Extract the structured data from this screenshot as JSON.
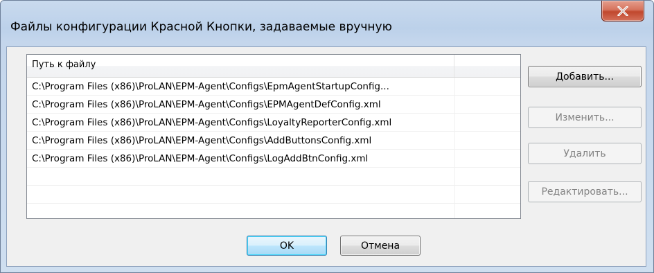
{
  "window": {
    "title": "Файлы конфигурации Красной Кнопки, задаваемые вручную",
    "close_icon": "close-x-icon"
  },
  "list": {
    "column_header": "Путь к файлу",
    "rows": [
      "C:\\Program Files (x86)\\ProLAN\\EPM-Agent\\Configs\\EpmAgentStartupConfig...",
      "C:\\Program Files (x86)\\ProLAN\\EPM-Agent\\Configs\\EPMAgentDefConfig.xml",
      "C:\\Program Files (x86)\\ProLAN\\EPM-Agent\\Configs\\LoyaltyReporterConfig.xml",
      "C:\\Program Files (x86)\\ProLAN\\EPM-Agent\\Configs\\AddButtonsConfig.xml",
      "C:\\Program Files (x86)\\ProLAN\\EPM-Agent\\Configs\\LogAddBtnConfig.xml"
    ]
  },
  "buttons": {
    "add": "Добавить...",
    "edit": "Изменить...",
    "delete": "Удалить",
    "modify": "Редактировать...",
    "ok": "OK",
    "cancel": "Отмена"
  },
  "colors": {
    "close_button": "#c7472c",
    "frame": "#c4d6ec",
    "disabled_text": "#838383"
  }
}
